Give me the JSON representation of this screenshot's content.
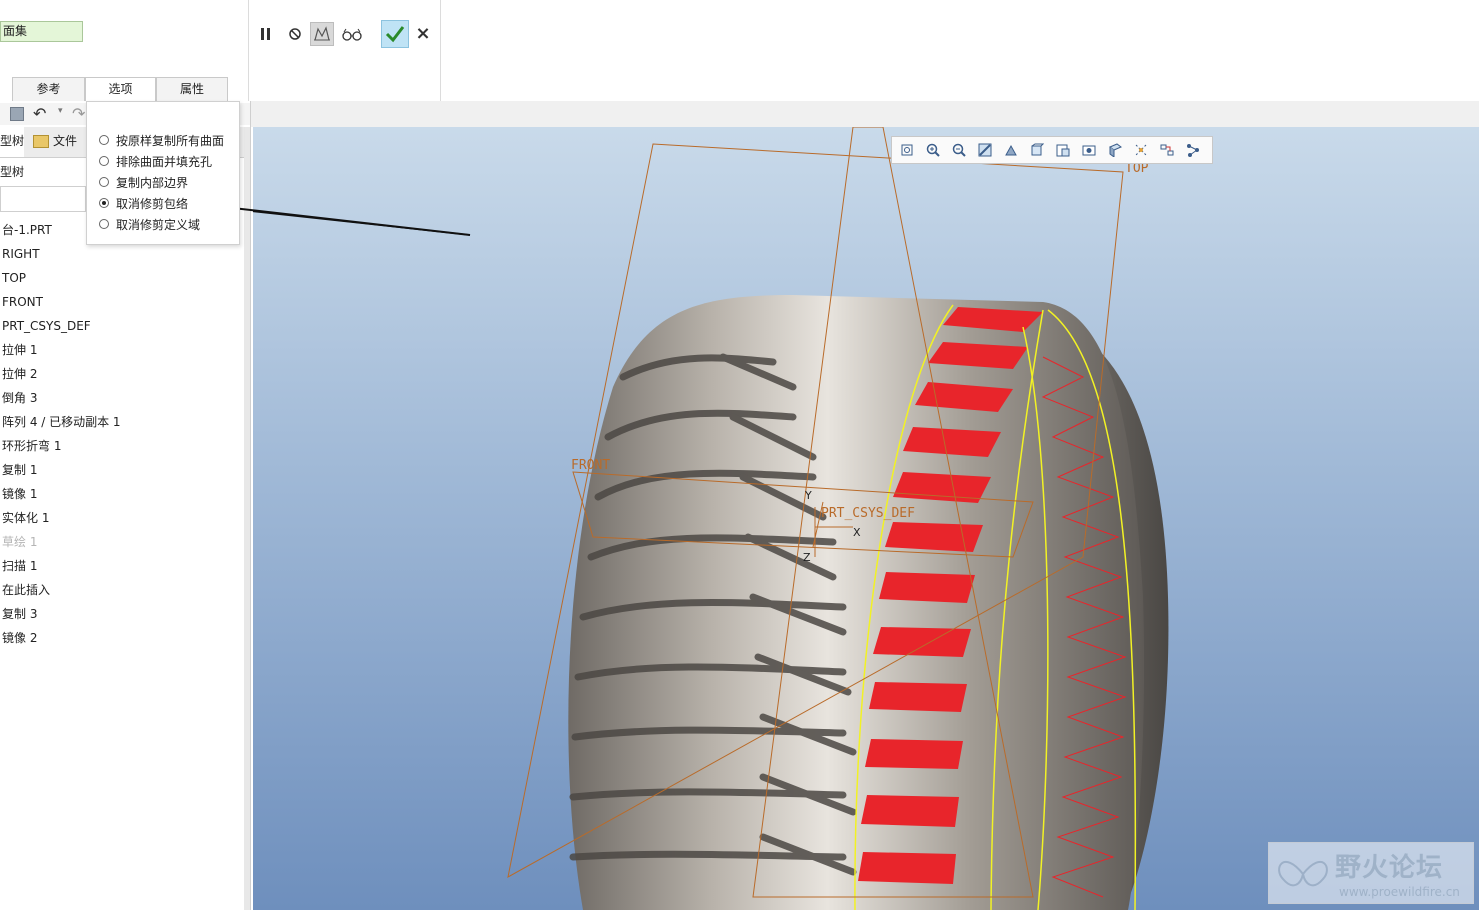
{
  "ribbon": {
    "collector_value": "面集",
    "tabs": [
      {
        "label": "参考",
        "active": false
      },
      {
        "label": "选项",
        "active": true
      },
      {
        "label": "属性",
        "active": false
      }
    ],
    "tools": [
      "pause-icon",
      "stop-icon",
      "preview-icon",
      "verify-icon"
    ],
    "ok_icon": "checkmark-icon",
    "cancel_label": "×"
  },
  "options_popup": {
    "items": [
      {
        "label": "按原样复制所有曲面",
        "selected": false
      },
      {
        "label": "排除曲面并填充孔",
        "selected": false
      },
      {
        "label": "复制内部边界",
        "selected": false
      },
      {
        "label": "取消修剪包络",
        "selected": true
      },
      {
        "label": "取消修剪定义域",
        "selected": false
      }
    ]
  },
  "left_panel": {
    "tab_model_tree": "型树",
    "tab_folder": "文件",
    "tree_header": "型树",
    "tree_items": [
      {
        "label": "台-1.PRT",
        "dim": false
      },
      {
        "label": "RIGHT",
        "dim": false
      },
      {
        "label": "TOP",
        "dim": false
      },
      {
        "label": "FRONT",
        "dim": false
      },
      {
        "label": "PRT_CSYS_DEF",
        "dim": false
      },
      {
        "label": "拉伸 1",
        "dim": false
      },
      {
        "label": "拉伸 2",
        "dim": false
      },
      {
        "label": "倒角 3",
        "dim": false
      },
      {
        "label": "阵列 4 / 已移动副本 1",
        "dim": false
      },
      {
        "label": "环形折弯 1",
        "dim": false
      },
      {
        "label": "复制 1",
        "dim": false
      },
      {
        "label": "镜像 1",
        "dim": false
      },
      {
        "label": "实体化 1",
        "dim": false
      },
      {
        "label": "草绘 1",
        "dim": true
      },
      {
        "label": "扫描 1",
        "dim": false
      },
      {
        "label": "在此插入",
        "dim": false
      },
      {
        "label": "复制 3",
        "dim": false
      },
      {
        "label": "镜像 2",
        "dim": false
      }
    ]
  },
  "viewport": {
    "plane_labels": {
      "top": "TOP",
      "front": "FRONT",
      "csys": "PRT_CSYS_DEF"
    },
    "axis_labels": {
      "x": "X",
      "y": "Y",
      "z": "Z"
    },
    "view_toolbar": [
      "refit-icon",
      "zoom-in-icon",
      "zoom-out-icon",
      "repaint-icon",
      "display-style-icon",
      "saved-views-icon",
      "view-manager-icon",
      "appearance-icon",
      "perspective-icon",
      "datum-display-icon",
      "spin-center-icon",
      "annotation-icon"
    ],
    "background_top": "#c9daea",
    "background_bottom": "#6e8fbd",
    "highlight_color": "#e8252b",
    "selection_color": "#f2f224"
  },
  "watermark": {
    "title": "野火论坛",
    "url": "www.proewildfire.cn"
  }
}
